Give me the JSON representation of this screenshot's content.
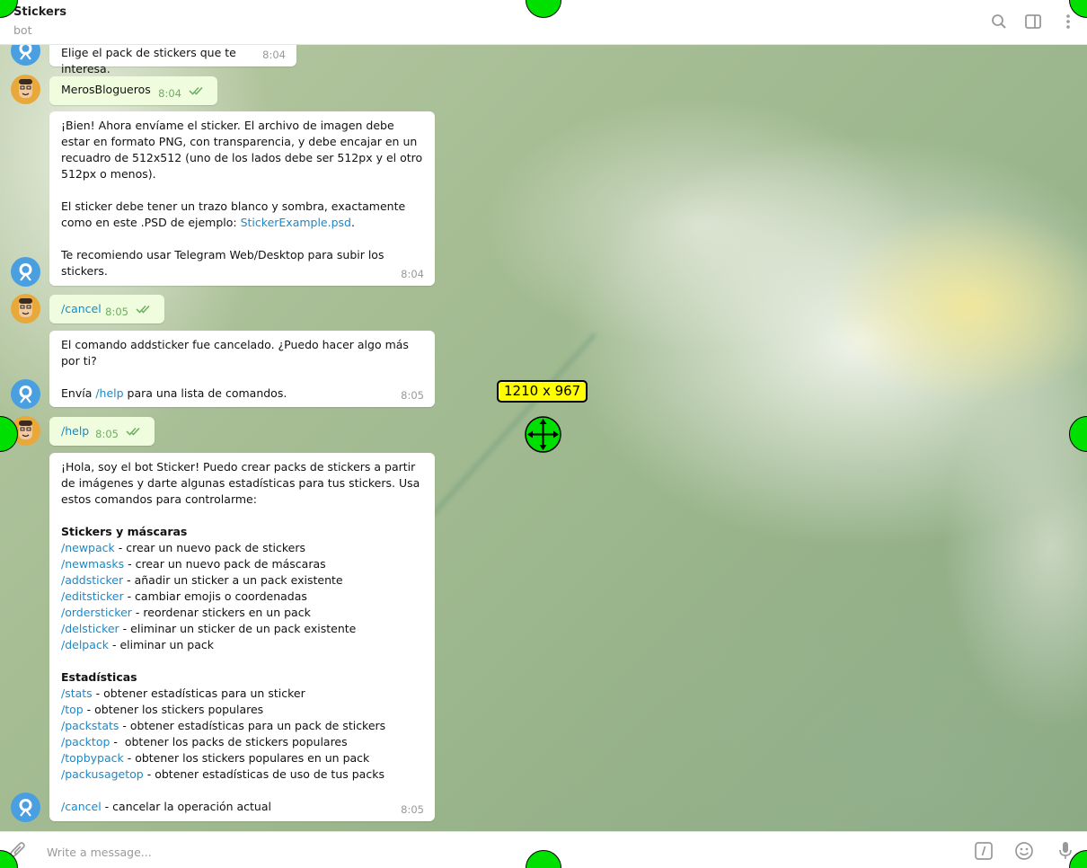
{
  "header": {
    "title": "Stickers",
    "subtitle": "bot",
    "icons": [
      "search-icon",
      "sidebar-toggle-icon",
      "more-vertical-icon"
    ]
  },
  "messages": [
    {
      "from": "bot",
      "text": "Elige el pack de stickers que te interesa.",
      "time": "8:04"
    },
    {
      "from": "user",
      "text": "MerosBlogueros",
      "time": "8:04",
      "read": true
    },
    {
      "from": "bot",
      "time": "8:04",
      "p1": "¡Bien! Ahora envíame el sticker. El archivo de imagen debe estar en formato PNG, con transparencia, y debe encajar en un recuadro de 512x512 (uno de los lados debe ser 512px y el otro 512px o menos).",
      "p2_before": "El sticker debe tener un trazo blanco y sombra, exactamente como en este .PSD de ejemplo: ",
      "p2_link": "StickerExample.psd",
      "p2_after": ".",
      "p3": "Te recomiendo usar Telegram Web/Desktop para subir los stickers."
    },
    {
      "from": "user",
      "text": "/cancel",
      "time": "8:05",
      "read": true
    },
    {
      "from": "bot",
      "time": "8:05",
      "p1": "El comando addsticker fue cancelado. ¿Puedo hacer algo más por ti?",
      "p2_before": "Envía ",
      "p2_link": "/help",
      "p2_after": " para una lista de comandos."
    },
    {
      "from": "user",
      "text": "/help",
      "time": "8:05",
      "read": true
    },
    {
      "from": "bot",
      "time": "8:05",
      "intro": "¡Hola, soy el bot Sticker! Puedo crear packs de stickers a partir de imágenes y darte algunas estadísticas para tus stickers. Usa estos comandos para controlarme:",
      "section1_title": "Stickers y máscaras",
      "section1_commands": [
        {
          "cmd": "/newpack",
          "desc": " - crear un nuevo pack de stickers"
        },
        {
          "cmd": "/newmasks",
          "desc": " - crear un nuevo pack de máscaras"
        },
        {
          "cmd": "/addsticker",
          "desc": " - añadir un sticker a un pack existente"
        },
        {
          "cmd": "/editsticker",
          "desc": " - cambiar emojis o coordenadas"
        },
        {
          "cmd": "/ordersticker",
          "desc": " - reordenar stickers en un pack"
        },
        {
          "cmd": "/delsticker",
          "desc": " - eliminar un sticker de un pack existente"
        },
        {
          "cmd": "/delpack",
          "desc": " - eliminar un pack"
        }
      ],
      "section2_title": "Estadísticas",
      "section2_commands": [
        {
          "cmd": "/stats",
          "desc": " - obtener estadísticas para un sticker"
        },
        {
          "cmd": "/top",
          "desc": " - obtener los stickers populares"
        },
        {
          "cmd": "/packstats",
          "desc": " - obtener estadísticas para un pack de stickers"
        },
        {
          "cmd": "/packtop",
          "desc": " -  obtener los packs de stickers populares"
        },
        {
          "cmd": "/topbypack",
          "desc": " - obtener los stickers populares en un pack"
        },
        {
          "cmd": "/packusagetop",
          "desc": " - obtener estadísticas de uso de tus packs"
        }
      ],
      "cancel_cmd": "/cancel",
      "cancel_desc": " - cancelar la operación actual"
    }
  ],
  "input": {
    "placeholder": "Write a message...",
    "icons": [
      "paperclip-icon",
      "bot-command-icon",
      "emoji-icon",
      "microphone-icon"
    ]
  },
  "overlay": {
    "dimension_label": "1210 x 967",
    "handle_color": "#00e000",
    "label_color": "#ffff00"
  },
  "colors": {
    "link": "#168acd",
    "outgoing_bubble": "#effdde",
    "read_check": "#6cae5f"
  }
}
